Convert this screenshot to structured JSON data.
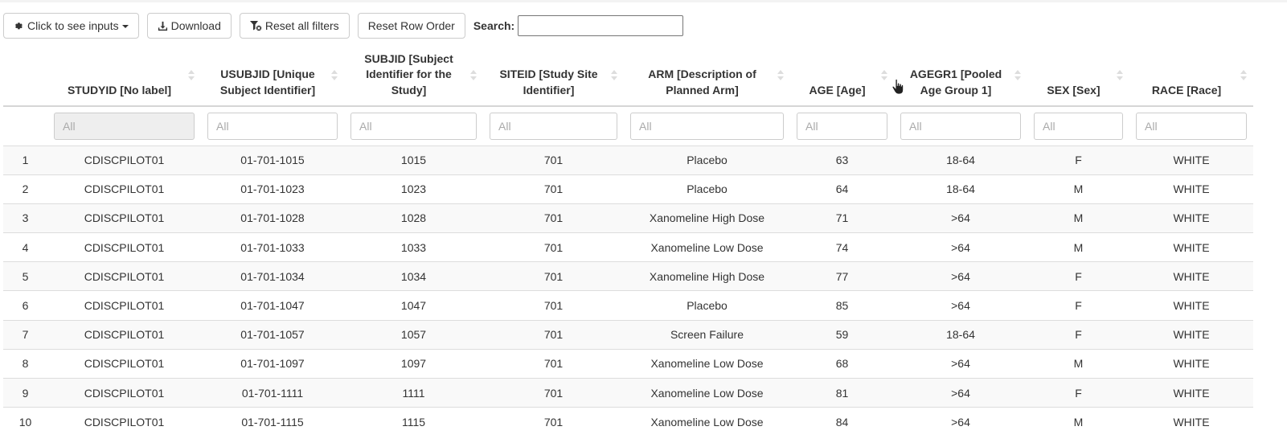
{
  "toolbar": {
    "inputs_label": "Click to see inputs",
    "download_label": "Download",
    "reset_filters_label": "Reset all filters",
    "reset_order_label": "Reset Row Order",
    "search_label": "Search:",
    "search_value": ""
  },
  "icons": {
    "inputs": "gear-icon",
    "download": "download-icon",
    "reset_filters": "filter-clear-icon",
    "cursor": "hand-pointer-icon"
  },
  "table": {
    "columns": [
      "",
      "STUDYID [No label]",
      "USUBJID [Unique Subject Identifier]",
      "SUBJID [Subject Identifier for the Study]",
      "SITEID [Study Site Identifier]",
      "ARM [Description of Planned Arm]",
      "AGE [Age]",
      "AGEGR1 [Pooled Age Group 1]",
      "SEX [Sex]",
      "RACE [Race]"
    ],
    "filter_placeholder": "All",
    "rows": [
      [
        "1",
        "CDISCPILOT01",
        "01-701-1015",
        "1015",
        "701",
        "Placebo",
        "63",
        "18-64",
        "F",
        "WHITE"
      ],
      [
        "2",
        "CDISCPILOT01",
        "01-701-1023",
        "1023",
        "701",
        "Placebo",
        "64",
        "18-64",
        "M",
        "WHITE"
      ],
      [
        "3",
        "CDISCPILOT01",
        "01-701-1028",
        "1028",
        "701",
        "Xanomeline High Dose",
        "71",
        ">64",
        "M",
        "WHITE"
      ],
      [
        "4",
        "CDISCPILOT01",
        "01-701-1033",
        "1033",
        "701",
        "Xanomeline Low Dose",
        "74",
        ">64",
        "M",
        "WHITE"
      ],
      [
        "5",
        "CDISCPILOT01",
        "01-701-1034",
        "1034",
        "701",
        "Xanomeline High Dose",
        "77",
        ">64",
        "F",
        "WHITE"
      ],
      [
        "6",
        "CDISCPILOT01",
        "01-701-1047",
        "1047",
        "701",
        "Placebo",
        "85",
        ">64",
        "F",
        "WHITE"
      ],
      [
        "7",
        "CDISCPILOT01",
        "01-701-1057",
        "1057",
        "701",
        "Screen Failure",
        "59",
        "18-64",
        "F",
        "WHITE"
      ],
      [
        "8",
        "CDISCPILOT01",
        "01-701-1097",
        "1097",
        "701",
        "Xanomeline Low Dose",
        "68",
        ">64",
        "M",
        "WHITE"
      ],
      [
        "9",
        "CDISCPILOT01",
        "01-701-1111",
        "1111",
        "701",
        "Xanomeline Low Dose",
        "81",
        ">64",
        "F",
        "WHITE"
      ],
      [
        "10",
        "CDISCPILOT01",
        "01-701-1115",
        "1115",
        "701",
        "Xanomeline Low Dose",
        "84",
        ">64",
        "M",
        "WHITE"
      ]
    ]
  }
}
